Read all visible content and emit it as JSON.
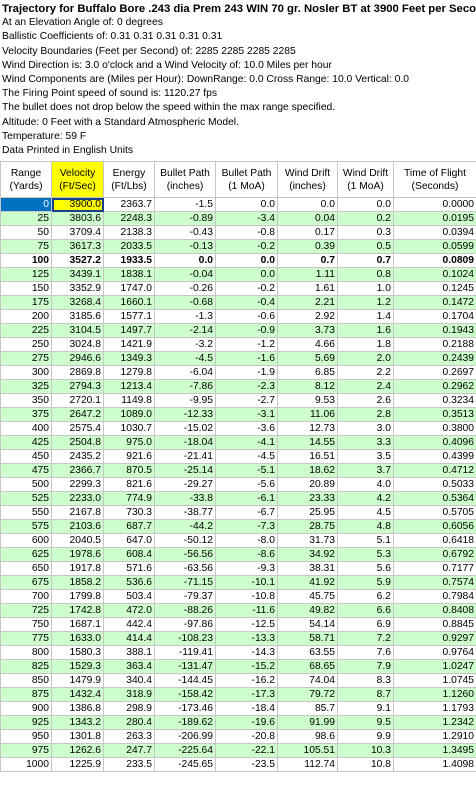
{
  "info_lines": [
    "Trajectory for Buffalo Bore .243 dia Prem 243 WIN 70 gr. Nosler BT at 3900 Feet per Seco",
    "At an Elevation Angle of: 0 degrees",
    "Ballistic Coefficients of: 0.31   0.31   0.31   0.31   0.31",
    "Velocity Boundaries (Feet per Second) of: 2285   2285   2285   2285",
    "Wind Direction is: 3.0 o'clock and a Wind Velocity of: 10.0 Miles per hour",
    "Wind Components are (Miles per Hour): DownRange: 0.0    Cross Range: 10.0    Vertical: 0.0",
    "The Firing Point speed of sound is: 1120.27 fps",
    "The bullet does not drop below the speed within the max range specified.",
    "Altitude: 0 Feet with a Standard Atmospheric Model.",
    "Temperature: 59 F",
    "Data Printed in English Units"
  ],
  "columns": [
    [
      "Range",
      "(Yards)"
    ],
    [
      "Velocity",
      "(Ft/Sec)"
    ],
    [
      "Energy",
      "(Ft/Lbs)"
    ],
    [
      "Bullet Path",
      "(inches)"
    ],
    [
      "Bullet Path",
      "(1 MoA)"
    ],
    [
      "Wind Drift",
      "(inches)"
    ],
    [
      "Wind Drift",
      "(1 MoA)"
    ],
    [
      "Time of Flight",
      "(Seconds)"
    ]
  ],
  "rows": [
    [
      "0",
      "3900.0",
      "2363.7",
      "-1.5",
      "0.0",
      "0.0",
      "0.0",
      "0.0000"
    ],
    [
      "25",
      "3803.6",
      "2248.3",
      "-0.89",
      "-3.4",
      "0.04",
      "0.2",
      "0.0195"
    ],
    [
      "50",
      "3709.4",
      "2138.3",
      "-0.43",
      "-0.8",
      "0.17",
      "0.3",
      "0.0394"
    ],
    [
      "75",
      "3617.3",
      "2033.5",
      "-0.13",
      "-0.2",
      "0.39",
      "0.5",
      "0.0599"
    ],
    [
      "100",
      "3527.2",
      "1933.5",
      "0.0",
      "0.0",
      "0.7",
      "0.7",
      "0.0809"
    ],
    [
      "125",
      "3439.1",
      "1838.1",
      "-0.04",
      "0.0",
      "1.11",
      "0.8",
      "0.1024"
    ],
    [
      "150",
      "3352.9",
      "1747.0",
      "-0.26",
      "-0.2",
      "1.61",
      "1.0",
      "0.1245"
    ],
    [
      "175",
      "3268.4",
      "1660.1",
      "-0.68",
      "-0.4",
      "2.21",
      "1.2",
      "0.1472"
    ],
    [
      "200",
      "3185.6",
      "1577.1",
      "-1.3",
      "-0.6",
      "2.92",
      "1.4",
      "0.1704"
    ],
    [
      "225",
      "3104.5",
      "1497.7",
      "-2.14",
      "-0.9",
      "3.73",
      "1.6",
      "0.1943"
    ],
    [
      "250",
      "3024.8",
      "1421.9",
      "-3.2",
      "-1.2",
      "4.66",
      "1.8",
      "0.2188"
    ],
    [
      "275",
      "2946.6",
      "1349.3",
      "-4.5",
      "-1.6",
      "5.69",
      "2.0",
      "0.2439"
    ],
    [
      "300",
      "2869.8",
      "1279.8",
      "-6.04",
      "-1.9",
      "6.85",
      "2.2",
      "0.2697"
    ],
    [
      "325",
      "2794.3",
      "1213.4",
      "-7.86",
      "-2.3",
      "8.12",
      "2.4",
      "0.2962"
    ],
    [
      "350",
      "2720.1",
      "1149.8",
      "-9.95",
      "-2.7",
      "9.53",
      "2.6",
      "0.3234"
    ],
    [
      "375",
      "2647.2",
      "1089.0",
      "-12.33",
      "-3.1",
      "11.06",
      "2.8",
      "0.3513"
    ],
    [
      "400",
      "2575.4",
      "1030.7",
      "-15.02",
      "-3.6",
      "12.73",
      "3.0",
      "0.3800"
    ],
    [
      "425",
      "2504.8",
      "975.0",
      "-18.04",
      "-4.1",
      "14.55",
      "3.3",
      "0.4096"
    ],
    [
      "450",
      "2435.2",
      "921.6",
      "-21.41",
      "-4.5",
      "16.51",
      "3.5",
      "0.4399"
    ],
    [
      "475",
      "2366.7",
      "870.5",
      "-25.14",
      "-5.1",
      "18.62",
      "3.7",
      "0.4712"
    ],
    [
      "500",
      "2299.3",
      "821.6",
      "-29.27",
      "-5.6",
      "20.89",
      "4.0",
      "0.5033"
    ],
    [
      "525",
      "2233.0",
      "774.9",
      "-33.8",
      "-6.1",
      "23.33",
      "4.2",
      "0.5364"
    ],
    [
      "550",
      "2167.8",
      "730.3",
      "-38.77",
      "-6.7",
      "25.95",
      "4.5",
      "0.5705"
    ],
    [
      "575",
      "2103.6",
      "687.7",
      "-44.2",
      "-7.3",
      "28.75",
      "4.8",
      "0.6056"
    ],
    [
      "600",
      "2040.5",
      "647.0",
      "-50.12",
      "-8.0",
      "31.73",
      "5.1",
      "0.6418"
    ],
    [
      "625",
      "1978.6",
      "608.4",
      "-56.56",
      "-8.6",
      "34.92",
      "5.3",
      "0.6792"
    ],
    [
      "650",
      "1917.8",
      "571.6",
      "-63.56",
      "-9.3",
      "38.31",
      "5.6",
      "0.7177"
    ],
    [
      "675",
      "1858.2",
      "536.6",
      "-71.15",
      "-10.1",
      "41.92",
      "5.9",
      "0.7574"
    ],
    [
      "700",
      "1799.8",
      "503.4",
      "-79.37",
      "-10.8",
      "45.75",
      "6.2",
      "0.7984"
    ],
    [
      "725",
      "1742.8",
      "472.0",
      "-88.26",
      "-11.6",
      "49.82",
      "6.6",
      "0.8408"
    ],
    [
      "750",
      "1687.1",
      "442.4",
      "-97.86",
      "-12.5",
      "54.14",
      "6.9",
      "0.8845"
    ],
    [
      "775",
      "1633.0",
      "414.4",
      "-108.23",
      "-13.3",
      "58.71",
      "7.2",
      "0.9297"
    ],
    [
      "800",
      "1580.3",
      "388.1",
      "-119.41",
      "-14.3",
      "63.55",
      "7.6",
      "0.9764"
    ],
    [
      "825",
      "1529.3",
      "363.4",
      "-131.47",
      "-15.2",
      "68.65",
      "7.9",
      "1.0247"
    ],
    [
      "850",
      "1479.9",
      "340.4",
      "-144.45",
      "-16.2",
      "74.04",
      "8.3",
      "1.0745"
    ],
    [
      "875",
      "1432.4",
      "318.9",
      "-158.42",
      "-17.3",
      "79.72",
      "8.7",
      "1.1260"
    ],
    [
      "900",
      "1386.8",
      "298.9",
      "-173.46",
      "-18.4",
      "85.7",
      "9.1",
      "1.1793"
    ],
    [
      "925",
      "1343.2",
      "280.4",
      "-189.62",
      "-19.6",
      "91.99",
      "9.5",
      "1.2342"
    ],
    [
      "950",
      "1301.8",
      "263.3",
      "-206.99",
      "-20.8",
      "98.6",
      "9.9",
      "1.2910"
    ],
    [
      "975",
      "1262.6",
      "247.7",
      "-225.64",
      "-22.1",
      "105.51",
      "10.3",
      "1.3495"
    ],
    [
      "1000",
      "1225.9",
      "233.5",
      "-245.65",
      "-23.5",
      "112.74",
      "10.8",
      "1.4098"
    ]
  ],
  "colors": {
    "alt_row": "#ccffcc",
    "velocity_header": "#ffff00",
    "selected_cell": "#0070c0",
    "grid_line": "#c6c6c6"
  }
}
